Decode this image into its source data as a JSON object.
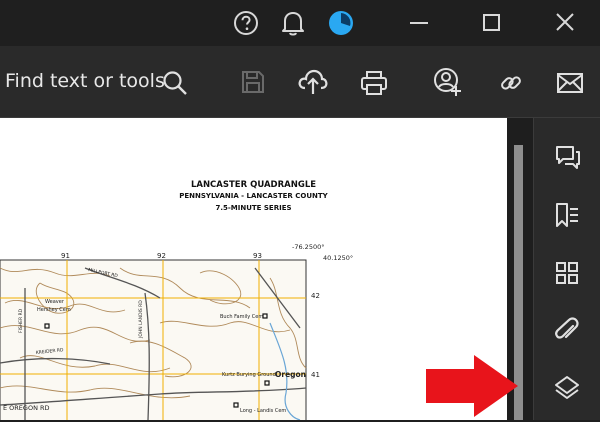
{
  "titlebar": {
    "help_icon": "help-circle-icon",
    "notifications_icon": "bell-icon",
    "profile_icon": "profile-avatar-icon",
    "window_controls": [
      "minimize-icon",
      "maximize-icon",
      "close-icon"
    ]
  },
  "toolbar": {
    "search_label": "Find text or tools",
    "icons": [
      "search-icon",
      "save-icon",
      "cloud-upload-icon",
      "print-icon",
      "share-user-icon",
      "link-icon",
      "email-icon"
    ]
  },
  "document": {
    "title": "LANCASTER QUADRANGLE",
    "subtitle": "PENNSYLVANIA - LANCASTER COUNTY",
    "series": "7.5-MINUTE SERIES",
    "map": {
      "grid_top": [
        "91",
        "92",
        "93"
      ],
      "grid_right": [
        "42",
        "41"
      ],
      "coord_lon": "-76.2500°",
      "coord_lat": "40.1250°",
      "roads": [
        "MILLPORT RD",
        "FISHER RD",
        "KREIDER RD",
        "JOHN LANDIS RD",
        "E OREGON RD"
      ],
      "places": [
        "Oregon"
      ],
      "cemeteries": [
        "Buch Family Cem",
        "Kurtz Burying Ground",
        "Long - Landis Cem",
        "Hershey Cem",
        "Weaver"
      ]
    }
  },
  "right_rail": {
    "icons": [
      "comment-icon",
      "bookmark-list-icon",
      "thumbnails-grid-icon",
      "attachment-icon",
      "layers-icon"
    ]
  },
  "colors": {
    "accent_profile": "#2aa8f2",
    "arrow": "#e8141b",
    "map_contour": "#b08a5a",
    "map_grid": "#f0b000"
  }
}
